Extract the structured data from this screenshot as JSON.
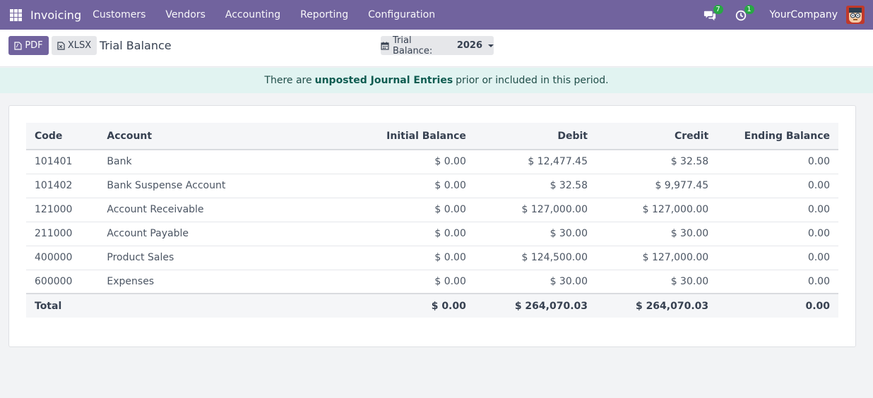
{
  "navbar": {
    "brand": "Invoicing",
    "menu": [
      "Customers",
      "Vendors",
      "Accounting",
      "Reporting",
      "Configuration"
    ],
    "messages_count": "7",
    "activities_count": "1",
    "company": "YourCompany",
    "bg_color": "#71639e",
    "badge_color": "#28a745"
  },
  "control": {
    "pdf_label": "PDF",
    "xlsx_label": "XLSX",
    "title": "Trial Balance",
    "period_label": "Trial Balance:",
    "period_value": "2026"
  },
  "alert": {
    "prefix": "There are",
    "strong": "unposted Journal Entries",
    "suffix": "prior or included in this period."
  },
  "table": {
    "headers": [
      "Code",
      "Account",
      "Initial Balance",
      "Debit",
      "Credit",
      "Ending Balance"
    ],
    "rows": [
      {
        "code": "101401",
        "account": "Bank",
        "initial": "$ 0.00",
        "debit": "$ 12,477.45",
        "credit": "$ 32.58",
        "ending": "0.00"
      },
      {
        "code": "101402",
        "account": "Bank Suspense Account",
        "initial": "$ 0.00",
        "debit": "$ 32.58",
        "credit": "$ 9,977.45",
        "ending": "0.00"
      },
      {
        "code": "121000",
        "account": "Account Receivable",
        "initial": "$ 0.00",
        "debit": "$ 127,000.00",
        "credit": "$ 127,000.00",
        "ending": "0.00"
      },
      {
        "code": "211000",
        "account": "Account Payable",
        "initial": "$ 0.00",
        "debit": "$ 30.00",
        "credit": "$ 30.00",
        "ending": "0.00"
      },
      {
        "code": "400000",
        "account": "Product Sales",
        "initial": "$ 0.00",
        "debit": "$ 124,500.00",
        "credit": "$ 127,000.00",
        "ending": "0.00"
      },
      {
        "code": "600000",
        "account": "Expenses",
        "initial": "$ 0.00",
        "debit": "$ 30.00",
        "credit": "$ 30.00",
        "ending": "0.00"
      }
    ],
    "total": {
      "label": "Total",
      "initial": "$ 0.00",
      "debit": "$ 264,070.03",
      "credit": "$ 264,070.03",
      "ending": "0.00"
    }
  }
}
